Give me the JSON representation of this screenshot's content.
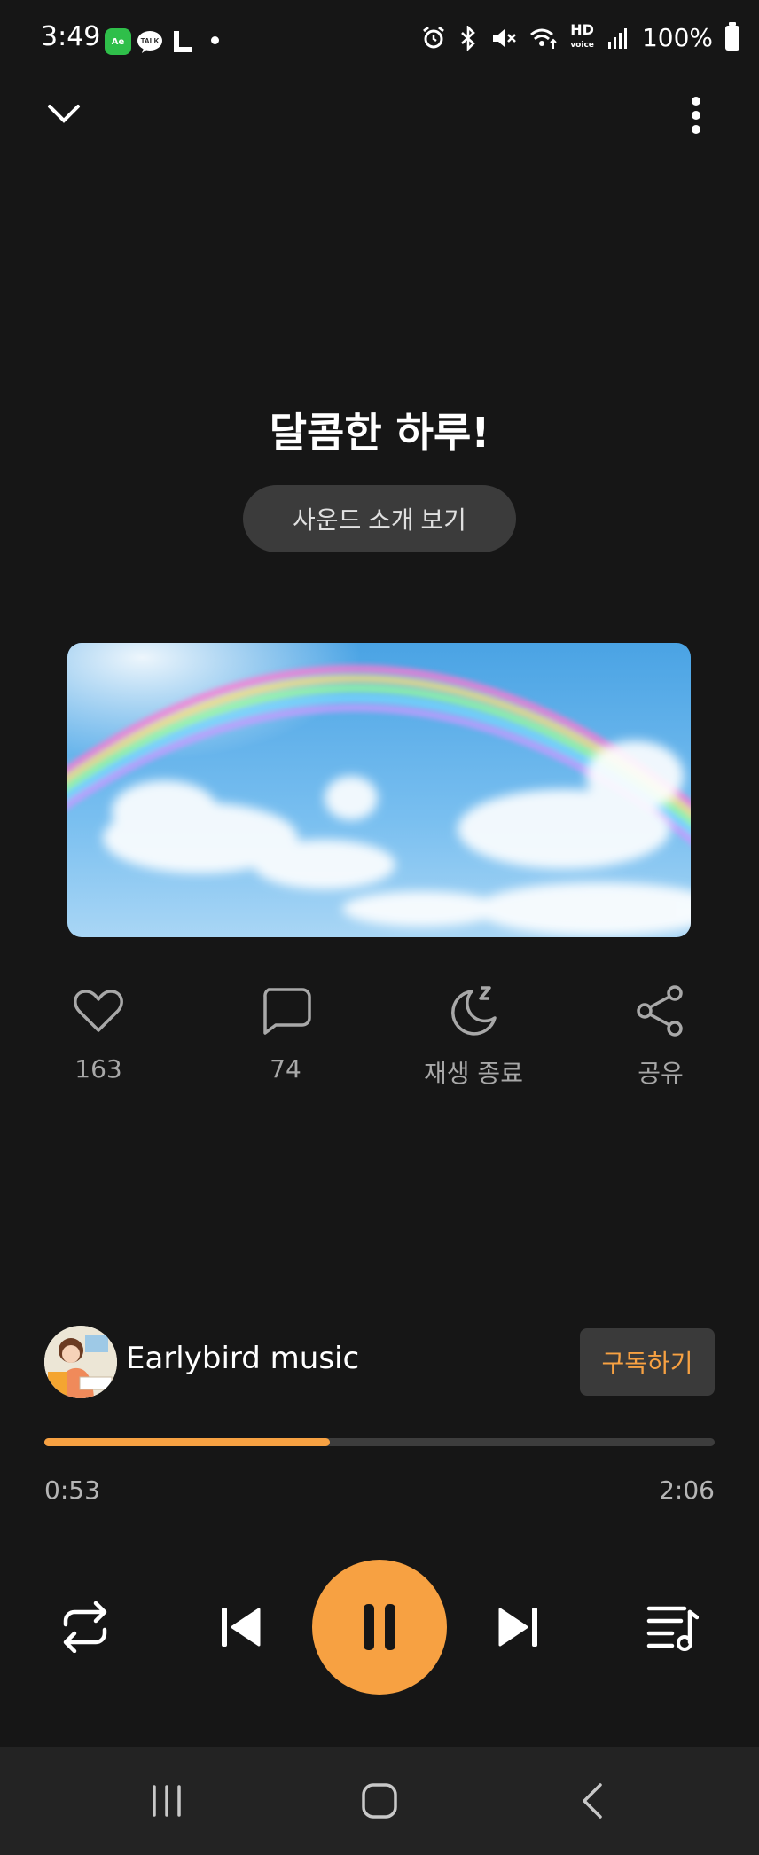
{
  "status_bar": {
    "time": "3:49",
    "app_icons": [
      "ae-app-icon",
      "kakaotalk-icon",
      "l-app-icon"
    ],
    "battery": "100%",
    "hd_label": "HD"
  },
  "track": {
    "title": "달콤한 하루!",
    "intro_button": "사운드 소개 보기"
  },
  "actions": {
    "like_count": "163",
    "comment_count": "74",
    "sleep_label": "재생 종료",
    "share_label": "공유"
  },
  "channel": {
    "name": "Earlybird music",
    "subscribe_label": "구독하기"
  },
  "playback": {
    "current_time": "0:53",
    "total_time": "2:06",
    "progress": 0.426,
    "state": "playing"
  },
  "colors": {
    "accent": "#f7a142",
    "background": "#161616",
    "button_bg": "#3b3b3b"
  }
}
